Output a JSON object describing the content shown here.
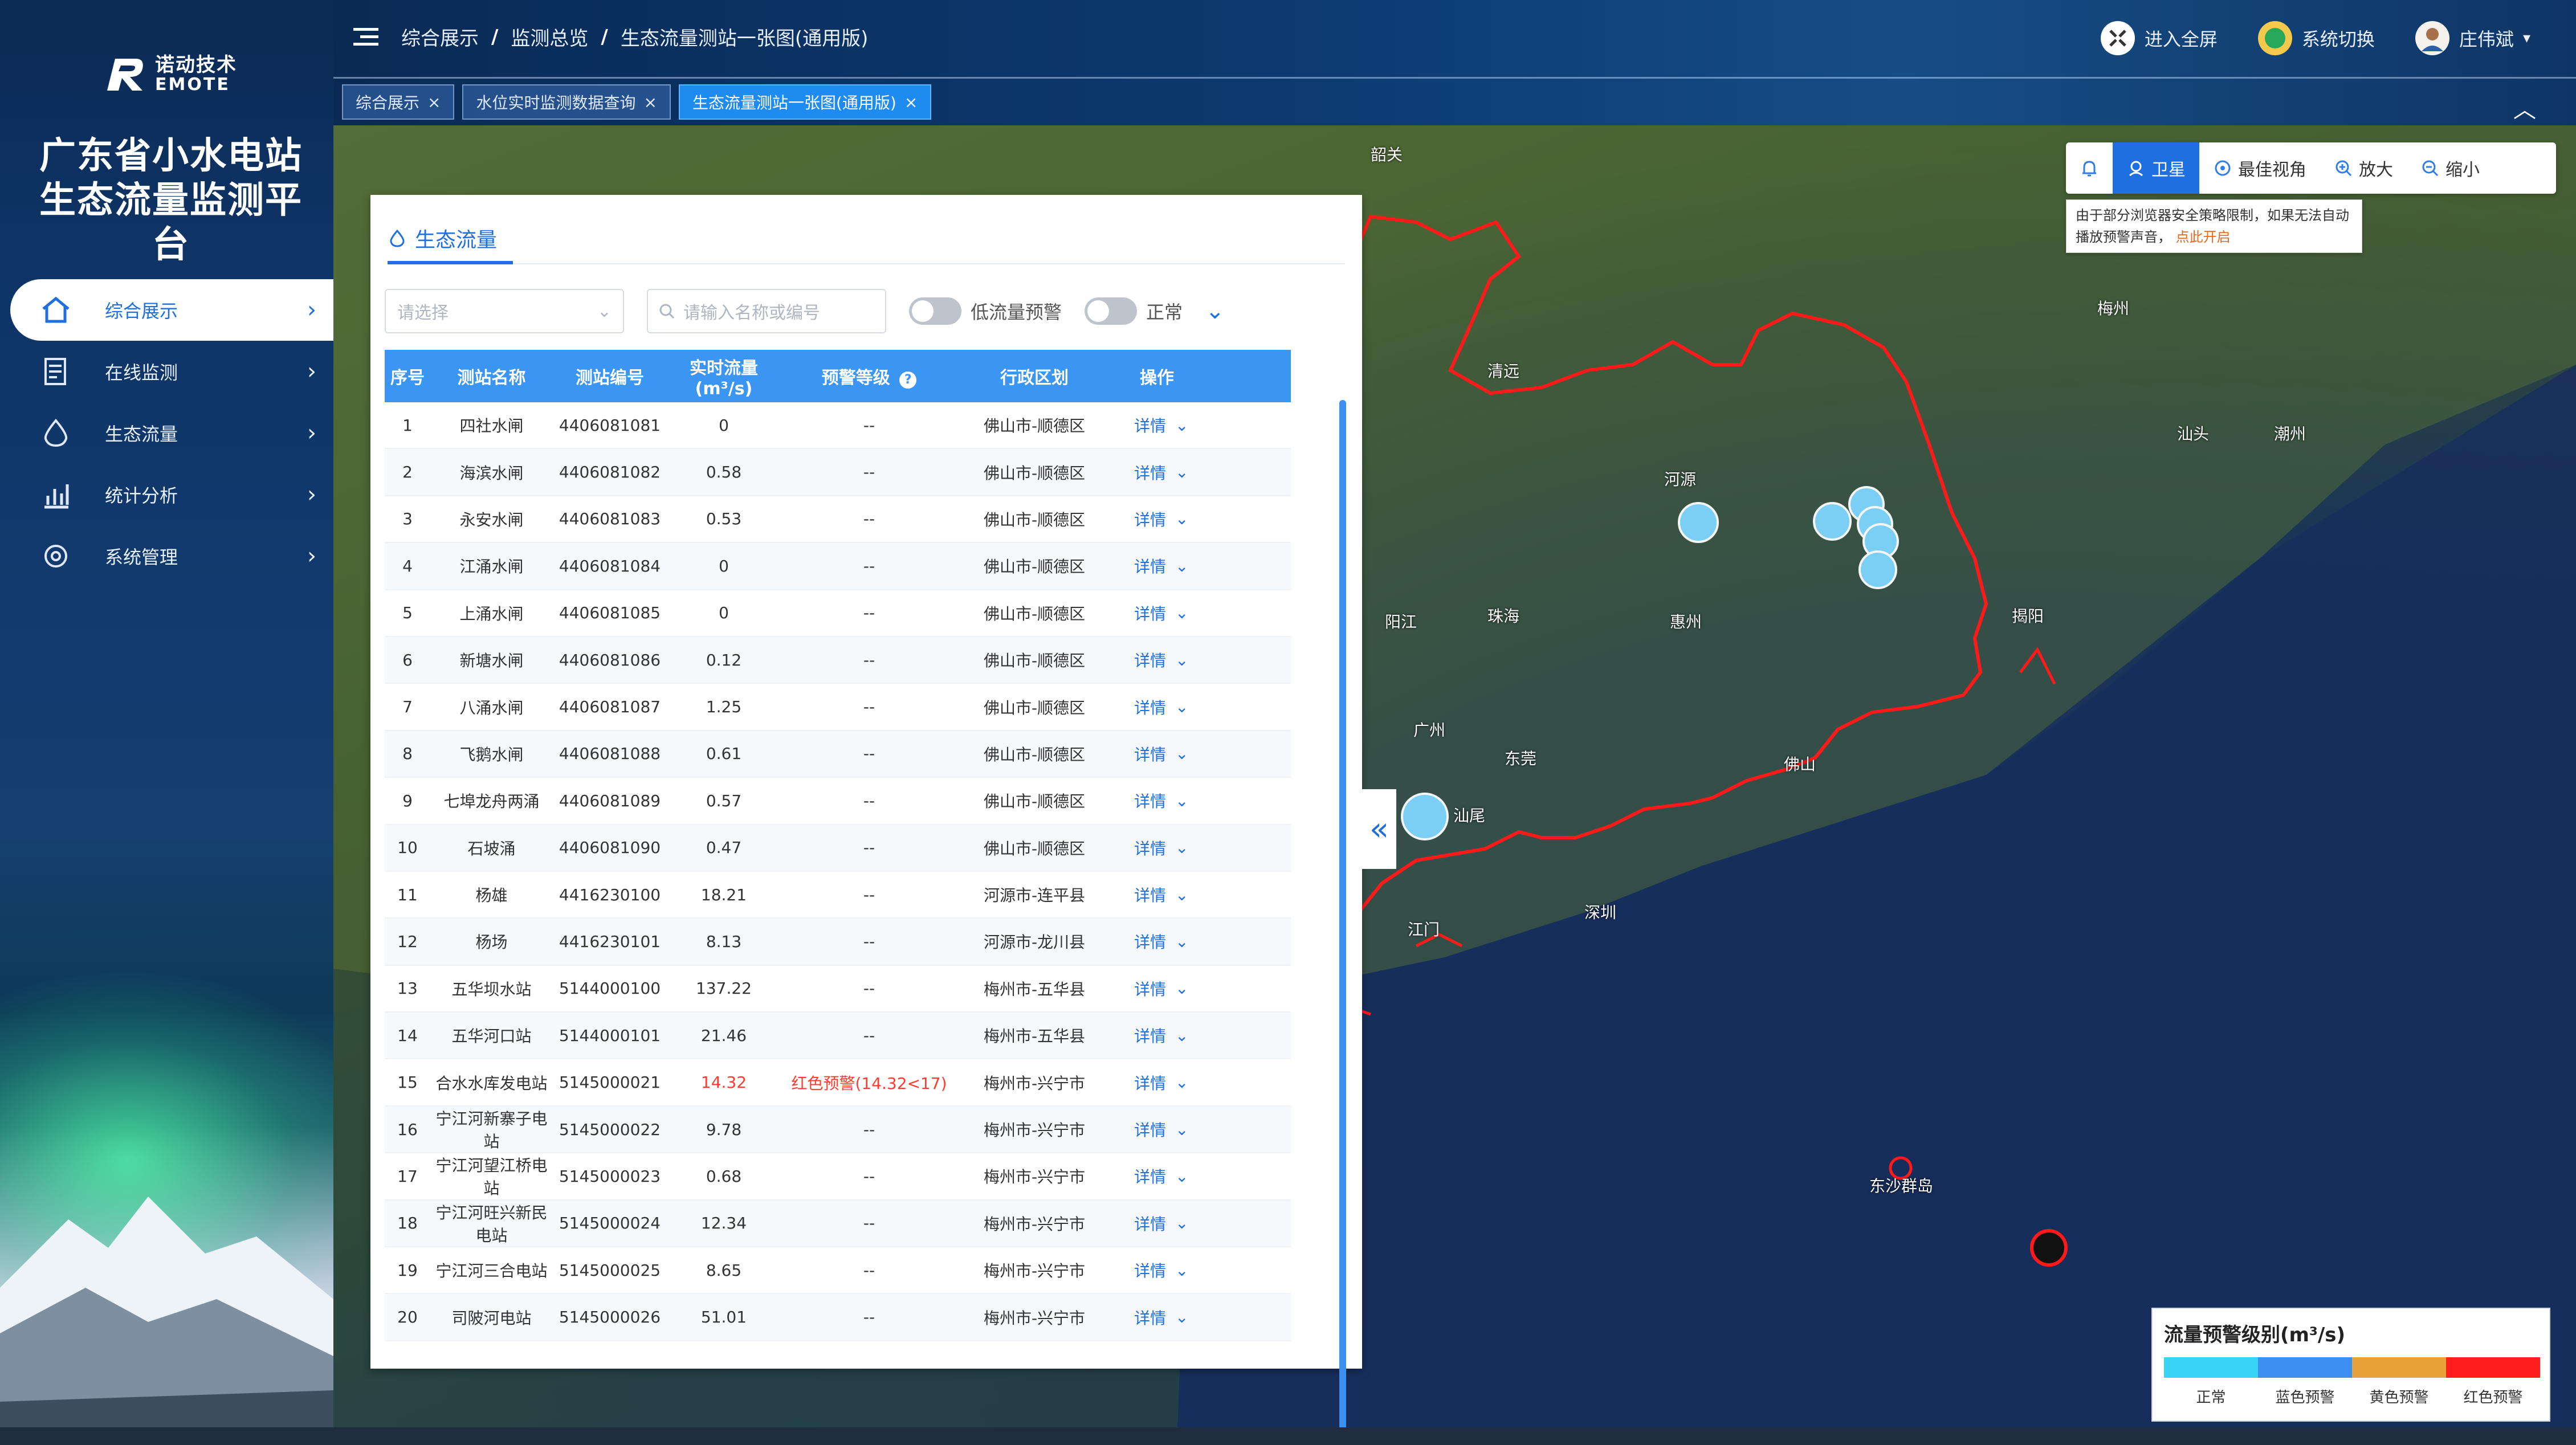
{
  "brand": {
    "logo_cn": "诺动技术",
    "logo_en": "EMOTE",
    "platform_title_lines": [
      "广东省小水电站",
      "生态流量监测平",
      "台"
    ]
  },
  "sidebar": {
    "items": [
      {
        "label": "综合展示",
        "icon": "home-icon",
        "active": true
      },
      {
        "label": "在线监测",
        "icon": "monitor-icon",
        "active": false
      },
      {
        "label": "生态流量",
        "icon": "water-drop-icon",
        "active": false
      },
      {
        "label": "统计分析",
        "icon": "bar-chart-icon",
        "active": false
      },
      {
        "label": "系统管理",
        "icon": "gear-icon",
        "active": false
      }
    ]
  },
  "header": {
    "breadcrumb": [
      "综合展示",
      "监测总览",
      "生态流量测站一张图(通用版)"
    ],
    "right": {
      "fullscreen": "进入全屏",
      "switch_system": "系统切换",
      "user": "庄伟斌"
    },
    "tabs": [
      {
        "label": "综合展示",
        "active": false
      },
      {
        "label": "水位实时监测数据查询",
        "active": false
      },
      {
        "label": "生态流量测站一张图(通用版)",
        "active": true
      }
    ]
  },
  "map_tools": {
    "items": [
      {
        "label": "",
        "icon": "bell-icon"
      },
      {
        "label": "卫星",
        "icon": "satellite-icon",
        "active": true
      },
      {
        "label": "最佳视角",
        "icon": "target-icon"
      },
      {
        "label": "放大",
        "icon": "zoom-in-icon"
      },
      {
        "label": "缩小",
        "icon": "zoom-out-icon"
      }
    ],
    "tooltip_text": "由于部分浏览器安全策略限制，如果无法自动播放预警声音，",
    "tooltip_link": "点此开启"
  },
  "panel": {
    "title": "生态流量",
    "select_placeholder": "请选择",
    "search_placeholder": "请输入名称或编号",
    "toggle_low": "低流量预警",
    "toggle_normal": "正常",
    "columns": [
      "序号",
      "测站名称",
      "测站编号",
      "实时流量(m³/s)",
      "预警等级",
      "行政区划",
      "操作"
    ],
    "rows": [
      {
        "no": "1",
        "name": "四社水闸",
        "code": "4406081081",
        "flow": "0",
        "level": "--",
        "region": "佛山市-顺德区",
        "op": "详情"
      },
      {
        "no": "2",
        "name": "海滨水闸",
        "code": "4406081082",
        "flow": "0.58",
        "level": "--",
        "region": "佛山市-顺德区",
        "op": "详情"
      },
      {
        "no": "3",
        "name": "永安水闸",
        "code": "4406081083",
        "flow": "0.53",
        "level": "--",
        "region": "佛山市-顺德区",
        "op": "详情"
      },
      {
        "no": "4",
        "name": "江涌水闸",
        "code": "4406081084",
        "flow": "0",
        "level": "--",
        "region": "佛山市-顺德区",
        "op": "详情"
      },
      {
        "no": "5",
        "name": "上涌水闸",
        "code": "4406081085",
        "flow": "0",
        "level": "--",
        "region": "佛山市-顺德区",
        "op": "详情"
      },
      {
        "no": "6",
        "name": "新塘水闸",
        "code": "4406081086",
        "flow": "0.12",
        "level": "--",
        "region": "佛山市-顺德区",
        "op": "详情"
      },
      {
        "no": "7",
        "name": "八涌水闸",
        "code": "4406081087",
        "flow": "1.25",
        "level": "--",
        "region": "佛山市-顺德区",
        "op": "详情"
      },
      {
        "no": "8",
        "name": "飞鹅水闸",
        "code": "4406081088",
        "flow": "0.61",
        "level": "--",
        "region": "佛山市-顺德区",
        "op": "详情"
      },
      {
        "no": "9",
        "name": "七埠龙舟两涌",
        "code": "4406081089",
        "flow": "0.57",
        "level": "--",
        "region": "佛山市-顺德区",
        "op": "详情"
      },
      {
        "no": "10",
        "name": "石坡涌",
        "code": "4406081090",
        "flow": "0.47",
        "level": "--",
        "region": "佛山市-顺德区",
        "op": "详情"
      },
      {
        "no": "11",
        "name": "杨雄",
        "code": "4416230100",
        "flow": "18.21",
        "level": "--",
        "region": "河源市-连平县",
        "op": "详情"
      },
      {
        "no": "12",
        "name": "杨场",
        "code": "4416230101",
        "flow": "8.13",
        "level": "--",
        "region": "河源市-龙川县",
        "op": "详情"
      },
      {
        "no": "13",
        "name": "五华坝水站",
        "code": "5144000100",
        "flow": "137.22",
        "level": "--",
        "region": "梅州市-五华县",
        "op": "详情"
      },
      {
        "no": "14",
        "name": "五华河口站",
        "code": "5144000101",
        "flow": "21.46",
        "level": "--",
        "region": "梅州市-五华县",
        "op": "详情"
      },
      {
        "no": "15",
        "name": "合水水库发电站",
        "code": "5145000021",
        "flow": "14.32",
        "level": "红色预警(14.32<17)",
        "region": "梅州市-兴宁市",
        "op": "详情",
        "warn": true
      },
      {
        "no": "16",
        "name": "宁江河新寨子电站",
        "code": "5145000022",
        "flow": "9.78",
        "level": "--",
        "region": "梅州市-兴宁市",
        "op": "详情"
      },
      {
        "no": "17",
        "name": "宁江河望江桥电站",
        "code": "5145000023",
        "flow": "0.68",
        "level": "--",
        "region": "梅州市-兴宁市",
        "op": "详情"
      },
      {
        "no": "18",
        "name": "宁江河旺兴新民电站",
        "code": "5145000024",
        "flow": "12.34",
        "level": "--",
        "region": "梅州市-兴宁市",
        "op": "详情"
      },
      {
        "no": "19",
        "name": "宁江河三合电站",
        "code": "5145000025",
        "flow": "8.65",
        "level": "--",
        "region": "梅州市-兴宁市",
        "op": "详情"
      },
      {
        "no": "20",
        "name": "司陂河电站",
        "code": "5145000026",
        "flow": "51.01",
        "level": "--",
        "region": "梅州市-兴宁市",
        "op": "详情"
      }
    ]
  },
  "legend": {
    "title": "流量预警级别(m³/s)",
    "items": [
      {
        "label": "正常",
        "color": "#38d3f5"
      },
      {
        "label": "蓝色预警",
        "color": "#3b8ff0"
      },
      {
        "label": "黄色预警",
        "color": "#e8a23a"
      },
      {
        "label": "红色预警",
        "color": "#ff1e1e"
      }
    ]
  },
  "map_labels": [
    "韶关",
    "清远",
    "河源",
    "梅州",
    "潮州",
    "汕头",
    "揭阳",
    "惠州",
    "广州",
    "东莞",
    "深圳",
    "江门",
    "珠海",
    "佛山",
    "汕尾",
    "阳江",
    "东沙群岛"
  ]
}
